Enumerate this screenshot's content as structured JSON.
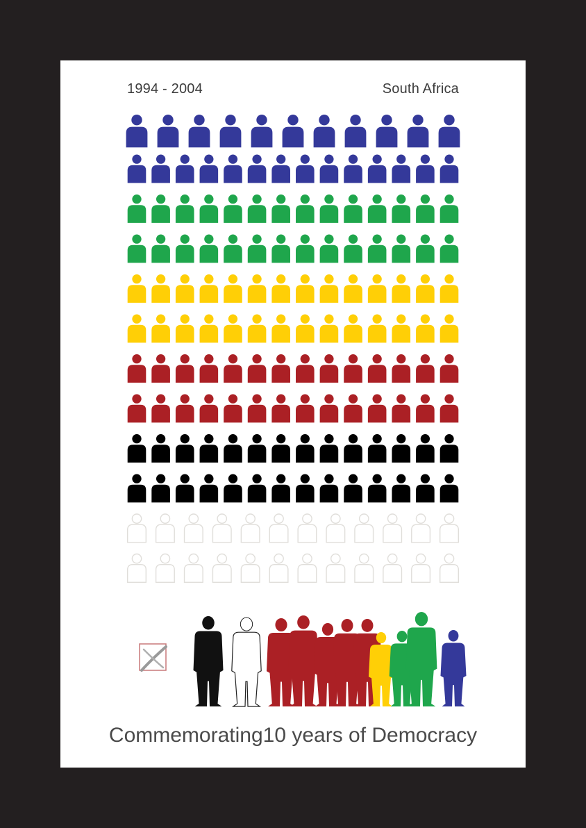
{
  "header": {
    "left": "1994 - 2004",
    "right": "South Africa"
  },
  "caption": "Commemorating10 years of Democracy",
  "grid": {
    "icon": "person-icon",
    "columns": 14,
    "rows": [
      {
        "color": "#34399a",
        "count": 11
      },
      {
        "color": "#34399a",
        "count": 14
      },
      {
        "color": "#1fa64c",
        "count": 14
      },
      {
        "color": "#1fa64c",
        "count": 14
      },
      {
        "color": "#ffcf06",
        "count": 14
      },
      {
        "color": "#ffcf06",
        "count": 14
      },
      {
        "color": "#ab2025",
        "count": 14
      },
      {
        "color": "#ab2025",
        "count": 14
      },
      {
        "color": "#000000",
        "count": 14
      },
      {
        "color": "#000000",
        "count": 14
      },
      {
        "color": "outline",
        "count": 12
      },
      {
        "color": "outline",
        "count": 12
      }
    ]
  },
  "silhouettes": [
    "#111111",
    "outline",
    "#ab2025",
    "#ab2025",
    "#ab2025",
    "#ab2025",
    "#ab2025",
    "#ffcf06",
    "#1fa64c",
    "#1fa64c",
    "#34399a"
  ],
  "ballot_icon": "ballot-cross-icon"
}
